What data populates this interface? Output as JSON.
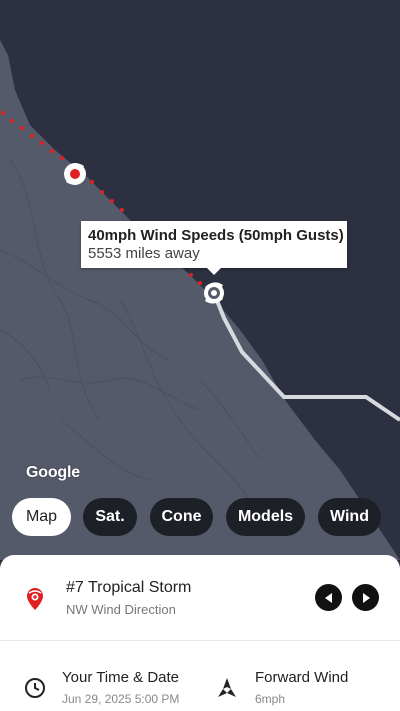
{
  "map": {
    "attribution": "Google",
    "colors": {
      "land": "#555a6a",
      "water": "#2c3040",
      "track_dots": "#e02020",
      "forecast_path": "#d7d9de"
    }
  },
  "tooltip": {
    "line1": "40mph Wind Speeds (50mph Gusts)",
    "line2": "5553 miles away"
  },
  "layers": {
    "items": [
      {
        "label": "Map",
        "active": true
      },
      {
        "label": "Sat.",
        "active": false
      },
      {
        "label": "Cone",
        "active": false
      },
      {
        "label": "Models",
        "active": false
      },
      {
        "label": "Wind",
        "active": false
      }
    ]
  },
  "storm": {
    "title": "#7 Tropical Storm",
    "subtitle": "NW Wind Direction",
    "icon": "storm-location-icon",
    "accent": "#e02020"
  },
  "info": {
    "time": {
      "title": "Your Time & Date",
      "value": "Jun 29, 2025 5:00 PM",
      "icon": "clock-icon"
    },
    "wind": {
      "title": "Forward Wind",
      "value": "6mph",
      "icon": "wind-direction-icon"
    }
  }
}
